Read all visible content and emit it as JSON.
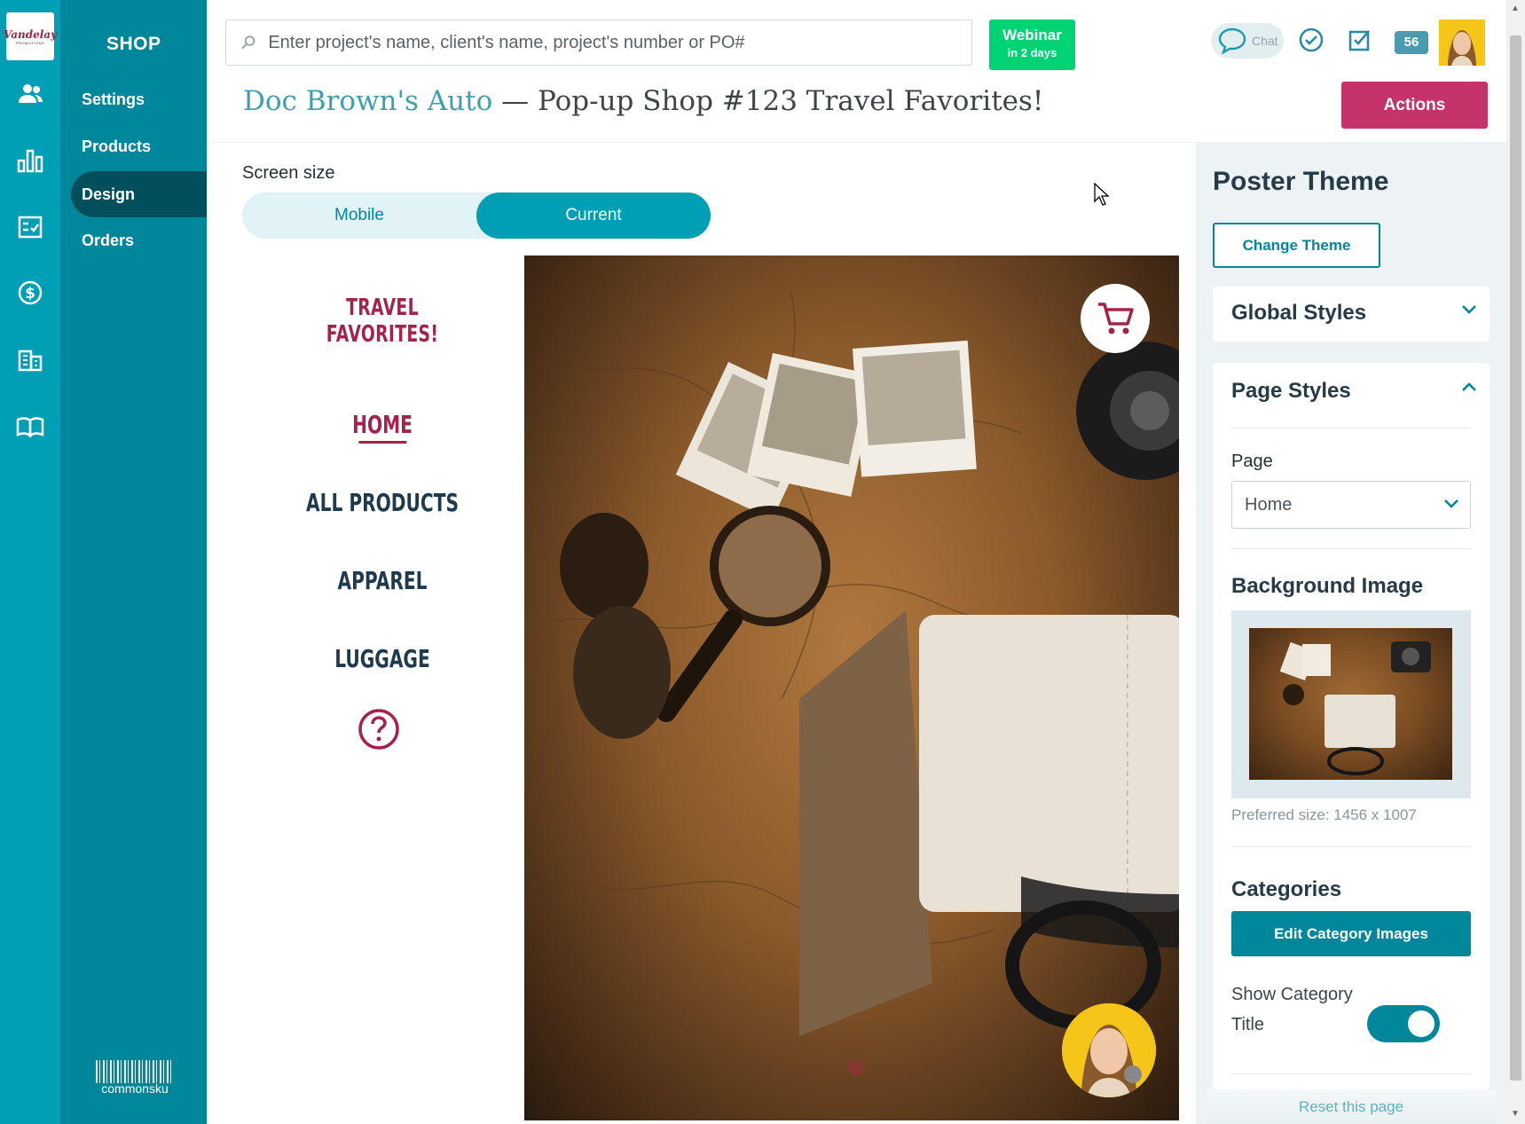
{
  "brand": {
    "logo_text": "Vandelay",
    "logo_sub": "PROMOTIONS",
    "footer_logo": "commonsku"
  },
  "subnav": {
    "title": "SHOP",
    "items": [
      {
        "label": "Settings"
      },
      {
        "label": "Products"
      },
      {
        "label": "Design",
        "active": true
      },
      {
        "label": "Orders"
      }
    ]
  },
  "iconbar": [
    "people-icon",
    "bar-chart-icon",
    "checklist-icon",
    "dollar-icon",
    "building-icon",
    "book-icon"
  ],
  "search": {
    "placeholder": "Enter project's name, client's name, project's number or PO#"
  },
  "webinar": {
    "line1": "Webinar",
    "line2": "in 2 days"
  },
  "topbar": {
    "chat_label": "Chat",
    "notifications_count": "56"
  },
  "page": {
    "client": "Doc Brown's Auto",
    "separator": " — ",
    "title": "Pop-up Shop #123 Travel Favorites!",
    "actions_label": "Actions"
  },
  "screen_size": {
    "label": "Screen size",
    "options": [
      "Mobile",
      "Current"
    ],
    "selected": "Current"
  },
  "preview": {
    "shop_title": "TRAVEL FAVORITES!",
    "nav": [
      {
        "label": "HOME",
        "active": true
      },
      {
        "label": "ALL PRODUCTS"
      },
      {
        "label": "APPAREL"
      },
      {
        "label": "LUGGAGE"
      }
    ]
  },
  "right_panel": {
    "title": "Poster Theme",
    "change_theme_label": "Change Theme",
    "global_styles": "Global Styles",
    "page_styles": "Page Styles",
    "page_label": "Page",
    "page_value": "Home",
    "background_image": "Background Image",
    "preferred_size": "Preferred size: 1456 x 1007",
    "categories": "Categories",
    "edit_category_images": "Edit Category Images",
    "show_category_title_line1": "Show Category",
    "show_category_title_line2": "Title",
    "show_category_title_on": true,
    "reset_label": "Reset this page"
  },
  "colors": {
    "teal": "#009fb5",
    "teal_dark": "#00879c",
    "crimson": "#a3234a",
    "actions": "#c6326a",
    "webinar": "#00d374"
  }
}
